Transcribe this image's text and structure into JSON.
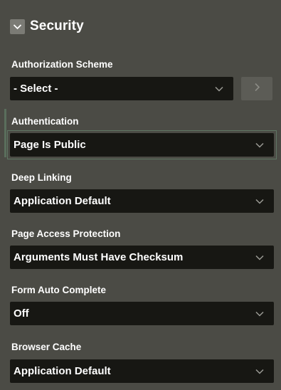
{
  "section": {
    "title": "Security",
    "toggle_icon": "chevron-down-icon"
  },
  "fields": [
    {
      "label": "Authorization Scheme",
      "value": "- Select -"
    },
    {
      "label": "Authentication",
      "value": "Page Is Public"
    },
    {
      "label": "Deep Linking",
      "value": "Application Default"
    },
    {
      "label": "Page Access Protection",
      "value": "Arguments Must Have Checksum"
    },
    {
      "label": "Form Auto Complete",
      "value": "Off"
    },
    {
      "label": "Browser Cache",
      "value": "Application Default"
    }
  ],
  "authorization_nav_icon": "chevron-right-icon",
  "colors": {
    "panel_background": "#4b4b45",
    "select_background": "#171713",
    "active_accent": "#5f7663"
  }
}
